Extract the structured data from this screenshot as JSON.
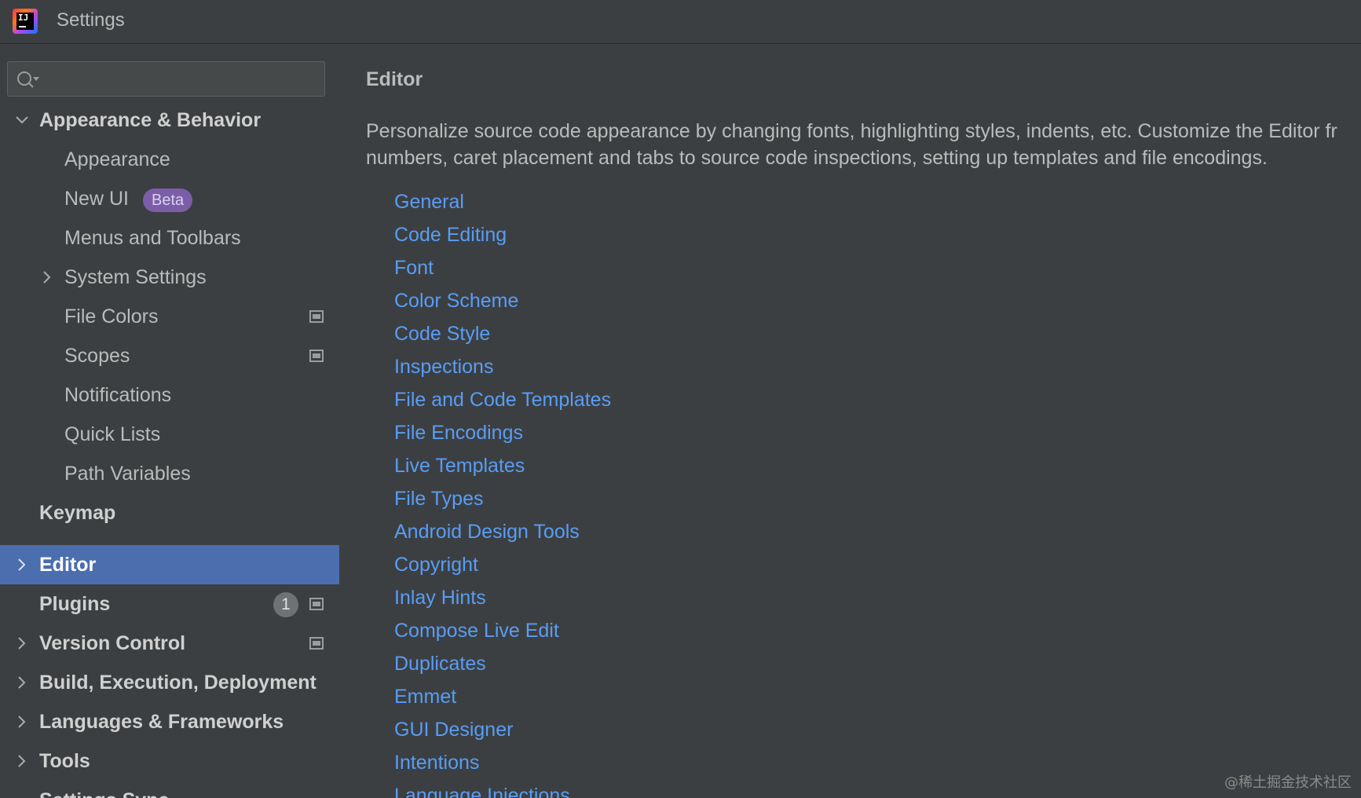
{
  "window": {
    "title": "Settings",
    "logo_text": "IJ"
  },
  "search": {
    "placeholder": "",
    "value": ""
  },
  "sidebar": {
    "items": [
      {
        "label": "Appearance & Behavior"
      },
      {
        "label": "Appearance"
      },
      {
        "label": "New UI",
        "badge": "Beta"
      },
      {
        "label": "Menus and Toolbars"
      },
      {
        "label": "System Settings"
      },
      {
        "label": "File Colors"
      },
      {
        "label": "Scopes"
      },
      {
        "label": "Notifications"
      },
      {
        "label": "Quick Lists"
      },
      {
        "label": "Path Variables"
      },
      {
        "label": "Keymap"
      },
      {
        "label": "Editor"
      },
      {
        "label": "Plugins",
        "count": "1"
      },
      {
        "label": "Version Control"
      },
      {
        "label": "Build, Execution, Deployment"
      },
      {
        "label": "Languages & Frameworks"
      },
      {
        "label": "Tools"
      },
      {
        "label": "Settings Sync"
      }
    ],
    "selected": "Editor"
  },
  "main": {
    "title": "Editor",
    "description_line1": "Personalize source code appearance by changing fonts, highlighting styles, indents, etc. Customize the Editor fr",
    "description_line2": "numbers, caret placement and tabs to source code inspections, setting up templates and file encodings.",
    "links": [
      "General",
      "Code Editing",
      "Font",
      "Color Scheme",
      "Code Style",
      "Inspections",
      "File and Code Templates",
      "File Encodings",
      "Live Templates",
      "File Types",
      "Android Design Tools",
      "Copyright",
      "Inlay Hints",
      "Compose Live Edit",
      "Duplicates",
      "Emmet",
      "GUI Designer",
      "Intentions",
      "Language Injections"
    ]
  },
  "watermark": "@稀土掘金技术社区",
  "colors": {
    "background": "#3c3f41",
    "selection": "#4b6eaf",
    "link": "#589df6",
    "beta_badge": "#7b5ea7"
  }
}
